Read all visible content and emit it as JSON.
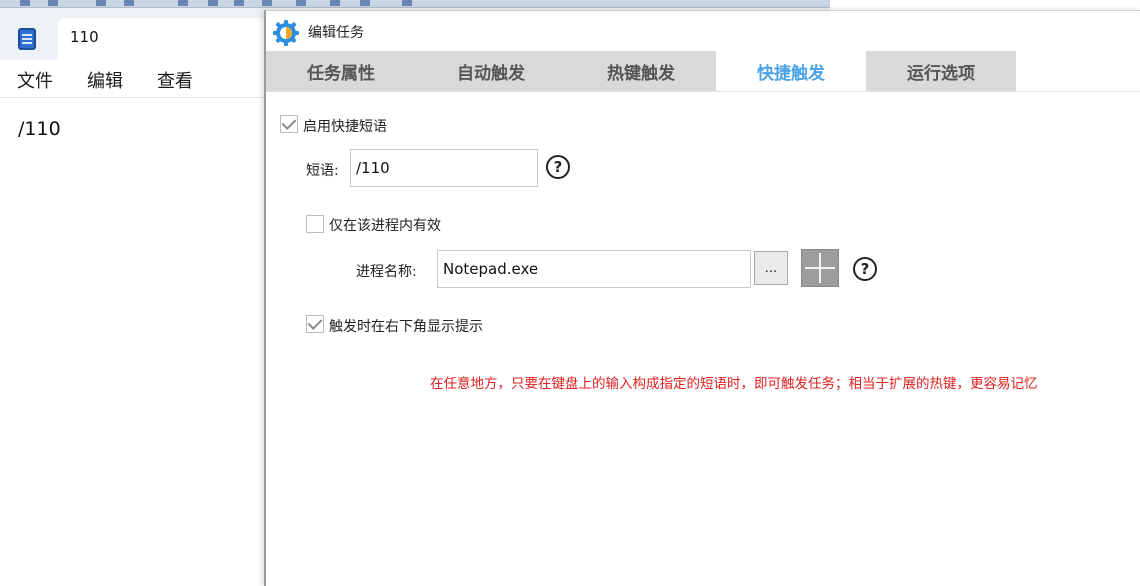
{
  "notepad": {
    "tab_title": "110",
    "menu": [
      "文件",
      "编辑",
      "查看"
    ],
    "content": "/110"
  },
  "dialog": {
    "title": "编辑任务",
    "tabs": [
      {
        "label": "任务属性",
        "active": false
      },
      {
        "label": "自动触发",
        "active": false
      },
      {
        "label": "热键触发",
        "active": false
      },
      {
        "label": "快捷触发",
        "active": true
      },
      {
        "label": "运行选项",
        "active": false
      }
    ],
    "enable_phrase": {
      "label": "启用快捷短语",
      "checked": true
    },
    "phrase": {
      "label": "短语:",
      "value": "/110"
    },
    "process_only": {
      "label": "仅在该进程内有效",
      "checked": false
    },
    "process_name": {
      "label": "进程名称:",
      "value": "Notepad.exe",
      "browse_label": "..."
    },
    "show_tip": {
      "label": "触发时在右下角显示提示",
      "checked": true
    },
    "help_glyph": "?",
    "hint": "在任意地方，只要在键盘上的输入构成指定的短语时，即可触发任务；相当于扩展的热键，更容易记忆"
  },
  "colors": {
    "active_tab": "#4aa3e8",
    "inactive_tab_bg": "#d9d9d9",
    "hint_red": "#e02020"
  }
}
